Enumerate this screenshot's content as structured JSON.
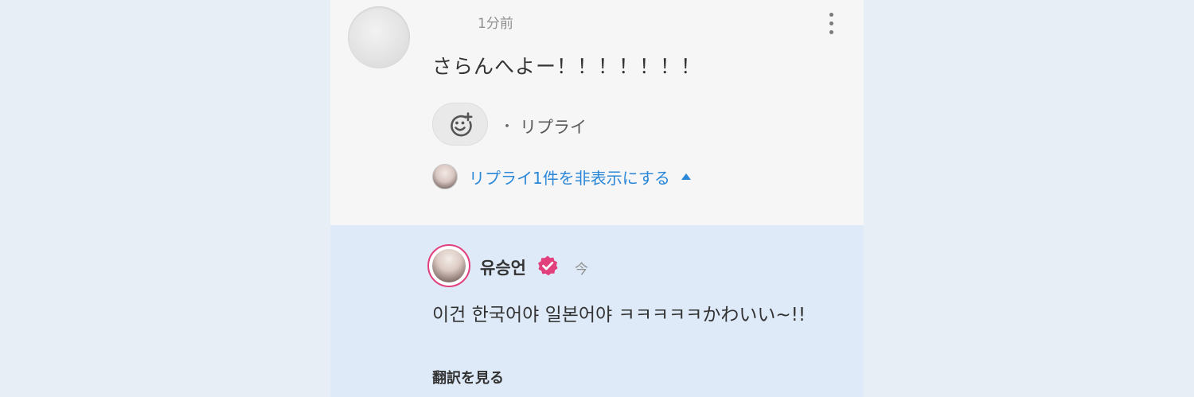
{
  "comment": {
    "time": "1分前",
    "text": "さらんへよー！！！！！！！",
    "reply_label": "リプライ",
    "separator": "・",
    "hide_replies_label": "リプライ1件を非表示にする"
  },
  "reply": {
    "username": "유승언",
    "time": "今",
    "text": "이건 한국어야 일본어야 ㅋㅋㅋㅋㅋかわいい~!!",
    "translate_label": "翻訳を見る"
  },
  "colors": {
    "link_blue": "#2b87d8",
    "verified_pink": "#e23f7d",
    "reply_bg": "#deeaf8",
    "page_bg": "#e8eef6"
  },
  "icons": {
    "more": "more-vertical-icon",
    "reaction": "add-reaction-icon",
    "caret": "caret-up-icon",
    "verified": "verified-badge-icon"
  }
}
